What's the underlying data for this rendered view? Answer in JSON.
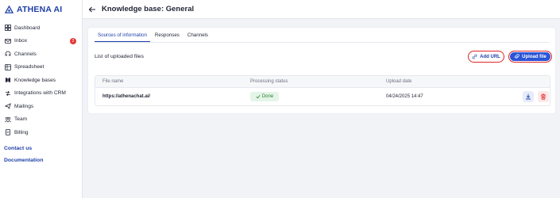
{
  "app": {
    "name": "ATHENA AI",
    "brand_color": "#1d3fa8",
    "accent_red": "#e02424"
  },
  "sidebar": {
    "items": [
      {
        "label": "Dashboard",
        "icon": "dashboard-icon"
      },
      {
        "label": "Inbox",
        "icon": "inbox-icon",
        "badge": "2"
      },
      {
        "label": "Channels",
        "icon": "channels-icon"
      },
      {
        "label": "Spreadsheet",
        "icon": "spreadsheet-icon"
      },
      {
        "label": "Knowledge bases",
        "icon": "book-icon"
      },
      {
        "label": "Integrations with CRM",
        "icon": "integrations-icon"
      },
      {
        "label": "Mailings",
        "icon": "mail-icon"
      },
      {
        "label": "Team",
        "icon": "team-icon"
      },
      {
        "label": "Billing",
        "icon": "billing-icon"
      }
    ],
    "contact_us": "Contact us",
    "documentation": "Documentation"
  },
  "header": {
    "title": "Knowledge base: General",
    "back_icon": "arrow-left-icon"
  },
  "tabs": [
    {
      "label": "Sources of information",
      "active": true
    },
    {
      "label": "Responses",
      "active": false
    },
    {
      "label": "Channels",
      "active": false
    }
  ],
  "files": {
    "section_title": "List of uploaded files",
    "add_url_label": "Add URL",
    "upload_label": "Upload file",
    "columns": [
      "File name",
      "Processing status",
      "Upload date"
    ],
    "rows": [
      {
        "file_name": "https://athenachat.ai/",
        "status": "Done",
        "date": "04/24/2025 14:47"
      }
    ]
  }
}
